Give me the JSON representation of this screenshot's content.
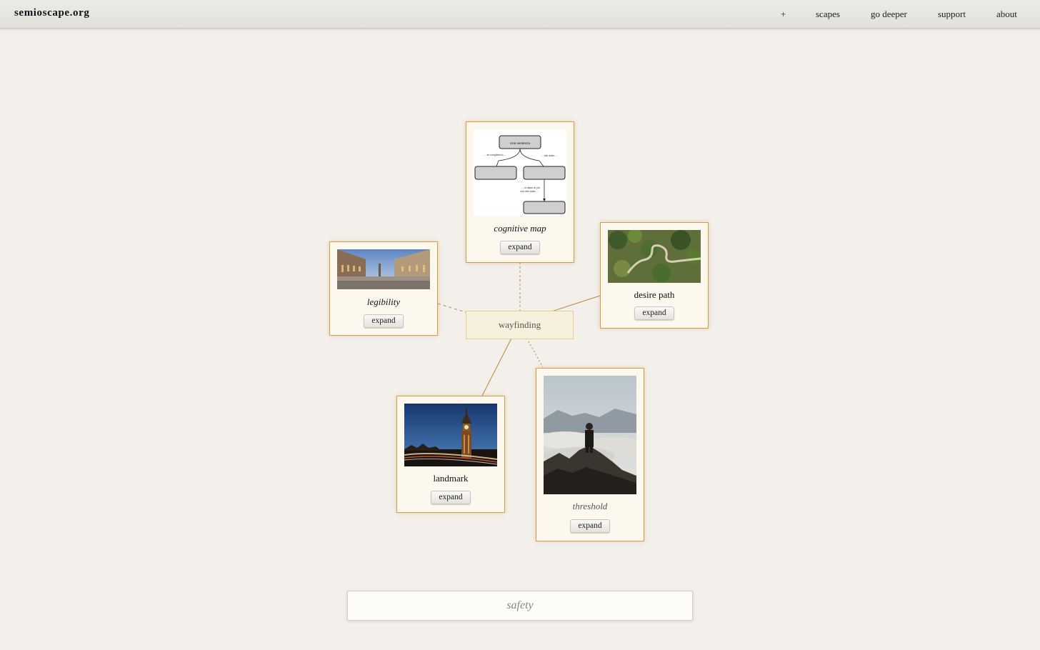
{
  "site": {
    "title": "semioscape.org"
  },
  "nav": {
    "plus": "+",
    "scapes": "scapes",
    "go_deeper": "go deeper",
    "support": "support",
    "about": "about"
  },
  "center": {
    "label": "wayfinding"
  },
  "cards": {
    "cognitive_map": {
      "title": "cognitive map",
      "expand": "expand",
      "diagram": {
        "top": "Una sentenza",
        "left_edge": "... se sceglieta to ...",
        "right_edge": "... allo stato ...",
        "bottom_edge_line1": "... si diace di più",
        "bottom_edge_line2": "che allo stato ..."
      }
    },
    "legibility": {
      "title": "legibility",
      "expand": "expand"
    },
    "desire_path": {
      "title": "desire path",
      "expand": "expand"
    },
    "landmark": {
      "title": "landmark",
      "expand": "expand"
    },
    "threshold": {
      "title": "threshold",
      "expand": "expand"
    }
  },
  "search": {
    "placeholder": "safety"
  },
  "colors": {
    "background": "#f3f0eb",
    "card_background": "#fdf8ee",
    "card_border": "#d39a4a",
    "center_background": "#f6f0dc",
    "link_line": "#b7843d"
  }
}
